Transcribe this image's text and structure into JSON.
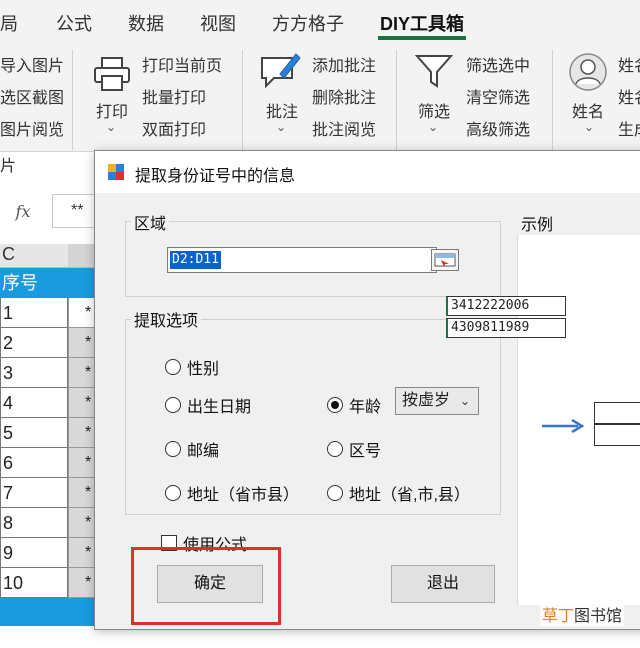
{
  "ribbon": {
    "tabs": [
      {
        "label": "局",
        "active": false
      },
      {
        "label": "公式",
        "active": false
      },
      {
        "label": "数据",
        "active": false
      },
      {
        "label": "视图",
        "active": false
      },
      {
        "label": "方方格子",
        "active": false
      },
      {
        "label": "DIY工具箱",
        "active": true
      }
    ],
    "left_items": [
      "导入图片",
      "选区截图",
      "图片阅览",
      "片"
    ],
    "print": {
      "big_label": "打印",
      "items": [
        "打印当前页",
        "批量打印",
        "双面打印"
      ]
    },
    "comment": {
      "big_label": "批注",
      "items": [
        "添加批注",
        "删除批注",
        "批注阅览"
      ]
    },
    "filter": {
      "big_label": "筛选",
      "items": [
        "筛选选中",
        "清空筛选",
        "高级筛选"
      ]
    },
    "name": {
      "big_label": "姓名",
      "items": [
        "姓名",
        "姓名",
        "生成"
      ]
    }
  },
  "formula_bar": {
    "fx": "fx",
    "value": "**"
  },
  "sheet": {
    "col_header": "C",
    "header_cell": "序号",
    "rows": [
      "1",
      "2",
      "3",
      "4",
      "5",
      "6",
      "7",
      "8",
      "9",
      "10"
    ],
    "masked": "*"
  },
  "dialog": {
    "title": "提取身份证号中的信息",
    "area_label": "区域",
    "range_value": "D2:D11",
    "options_label": "提取选项",
    "options": {
      "gender": "性别",
      "birth_date": "出生日期",
      "age": "年龄",
      "zip": "邮编",
      "area_code": "区号",
      "address_a": "地址（省市县）",
      "address_b": "地址（省,市,县）"
    },
    "selected_option": "年龄",
    "age_mode": "按虚岁",
    "use_formula": "使用公式",
    "ok": "确定",
    "exit": "退出",
    "example_label": "示例",
    "example_ids": [
      "3412222006",
      "4309811989"
    ],
    "accent_color": "#d9312b"
  },
  "watermark": {
    "part1": "草丁",
    "part2": "图书馆"
  }
}
